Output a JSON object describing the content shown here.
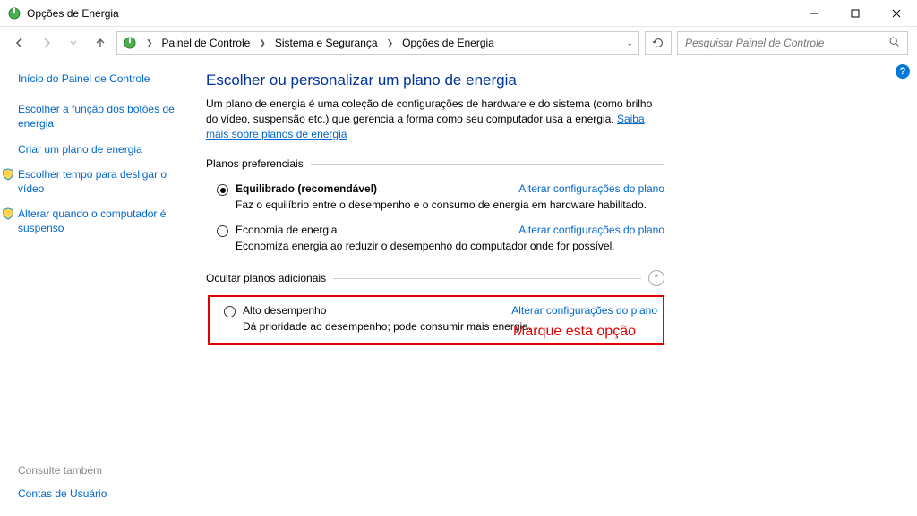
{
  "titlebar": {
    "title": "Opções de Energia"
  },
  "breadcrumbs": {
    "b1": "Painel de Controle",
    "b2": "Sistema e Segurança",
    "b3": "Opções de Energia"
  },
  "search": {
    "placeholder": "Pesquisar Painel de Controle"
  },
  "sidebar": {
    "home": "Início do Painel de Controle",
    "l1": "Escolher a função dos botões de energia",
    "l2": "Criar um plano de energia",
    "l3": "Escolher tempo para desligar o vídeo",
    "l4": "Alterar quando o computador é suspenso"
  },
  "heading": "Escolher ou personalizar um plano de energia",
  "intro_text": "Um plano de energia é uma coleção de configurações de hardware e do sistema (como brilho do vídeo, suspensão etc.) que gerencia a forma como seu computador usa a energia. ",
  "intro_link": "Saiba mais sobre planos de energia",
  "section_pref": "Planos preferenciais",
  "section_add": "Ocultar planos adicionais",
  "plans": {
    "p1": {
      "name": "Equilibrado (recomendável)",
      "desc": "Faz o equilíbrio entre o desempenho e o consumo de energia em hardware habilitado."
    },
    "p2": {
      "name": "Economia de energia",
      "desc": "Economiza energia ao reduzir o desempenho do computador onde for possível."
    },
    "p3": {
      "name": "Alto desempenho",
      "desc": "Dá prioridade ao desempenho; pode consumir mais energia."
    }
  },
  "change_link": "Alterar configurações do plano",
  "annotation": "Marque esta opção",
  "footer": {
    "label": "Consulte também",
    "link": "Contas de Usuário"
  }
}
